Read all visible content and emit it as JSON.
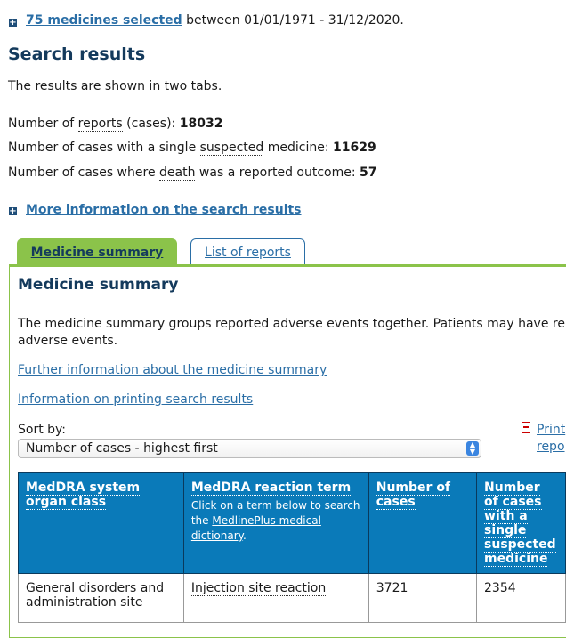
{
  "selection": {
    "link": "75 medicines selected",
    "range": "between 01/01/1971 - 31/12/2020."
  },
  "heading": "Search results",
  "intro": "The results are shown in two tabs.",
  "stats": [
    {
      "pre": "Number of ",
      "term": "reports",
      "post": " (cases): ",
      "value": "18032"
    },
    {
      "pre": "Number of cases with a single ",
      "term": "suspected",
      "post": " medicine: ",
      "value": "11629"
    },
    {
      "pre": "Number of cases where ",
      "term": "death",
      "post": " was a reported outcome: ",
      "value": "57"
    }
  ],
  "more_info": "More information on the search results",
  "tabs": [
    {
      "label": "Medicine summary",
      "active": true
    },
    {
      "label": "List of reports",
      "active": false
    }
  ],
  "panel": {
    "title": "Medicine summary",
    "desc_line1": "The medicine summary groups reported adverse events together. Patients may have re",
    "desc_line2": "adverse events.",
    "link_further": "Further information about the medicine summary",
    "link_printing": "Information on printing search results",
    "sort_label": "Sort by:",
    "sort_value": "Number of cases - highest first",
    "print_line1": "Print",
    "print_line2": "repo"
  },
  "table": {
    "col1": "MedDRA system organ class",
    "col2": "MedDRA reaction term",
    "col2_sub_pre": "Click on a term below to search the ",
    "col2_sub_link": "MedlinePlus medical dictionary",
    "col2_sub_post": ".",
    "col3": "Number of cases",
    "col4": "Number of cases with a single suspected medicine",
    "rows": [
      {
        "soc": "General disorders and administration site",
        "term": "Injection site reaction",
        "cases": "3721",
        "single": "2354"
      }
    ]
  },
  "colors": {
    "link": "#2a6ea6",
    "tab_active": "#8bc34a",
    "header_bg": "#0a7ab9",
    "heading": "#143a5c"
  }
}
